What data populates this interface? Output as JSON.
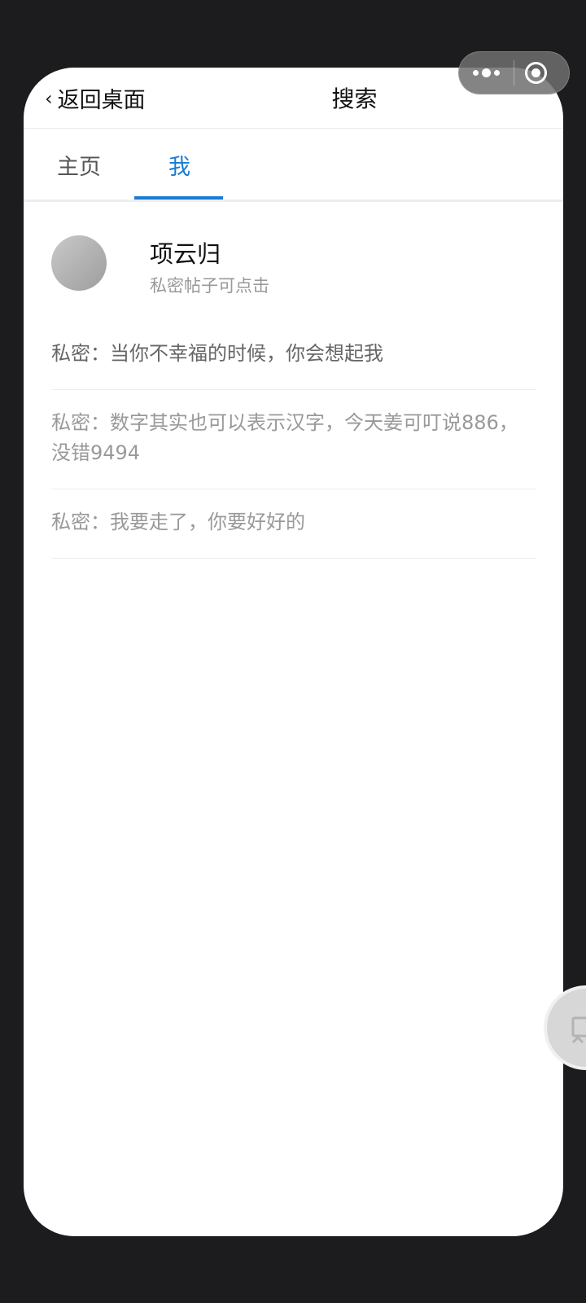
{
  "navbar": {
    "back_label": "返回桌面",
    "back_chevron": "‹",
    "title": "搜索"
  },
  "capsule": {
    "more_icon": "more-dots-icon",
    "close_icon": "target-circle-icon"
  },
  "tabs": [
    {
      "label": "主页",
      "active": false
    },
    {
      "label": "我",
      "active": true
    }
  ],
  "accent_color": "#1a7bd3",
  "profile": {
    "name": "项云归",
    "subtitle": "私密帖子可点击"
  },
  "posts": [
    {
      "text": "私密：当你不幸福的时候，你会想起我"
    },
    {
      "text": "私密：数字其实也可以表示汉字，今天姜可叮说886，没错9494"
    },
    {
      "text": "私密：我要走了，你要好好的"
    }
  ]
}
